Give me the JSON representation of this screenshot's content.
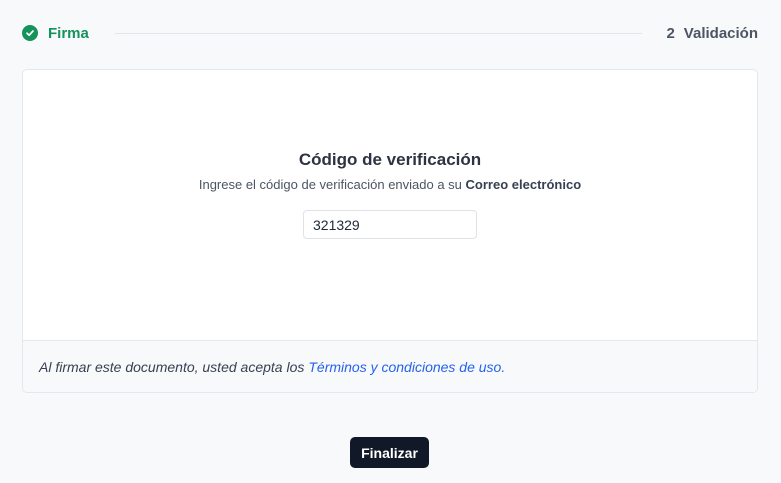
{
  "stepper": {
    "step1_label": "Firma",
    "step2_number": "2",
    "step2_label": "Validación",
    "done_color": "#15935b"
  },
  "card": {
    "title": "Código de verificación",
    "subtitle_prefix": "Ingrese el código de verificación enviado a su",
    "subtitle_bold": "Correo electrónico",
    "code_value": "321329"
  },
  "footer": {
    "text": "Al firmar este documento, usted acepta los",
    "link_text": "Términos y condiciones de uso."
  },
  "actions": {
    "finish_label": "Finalizar"
  }
}
